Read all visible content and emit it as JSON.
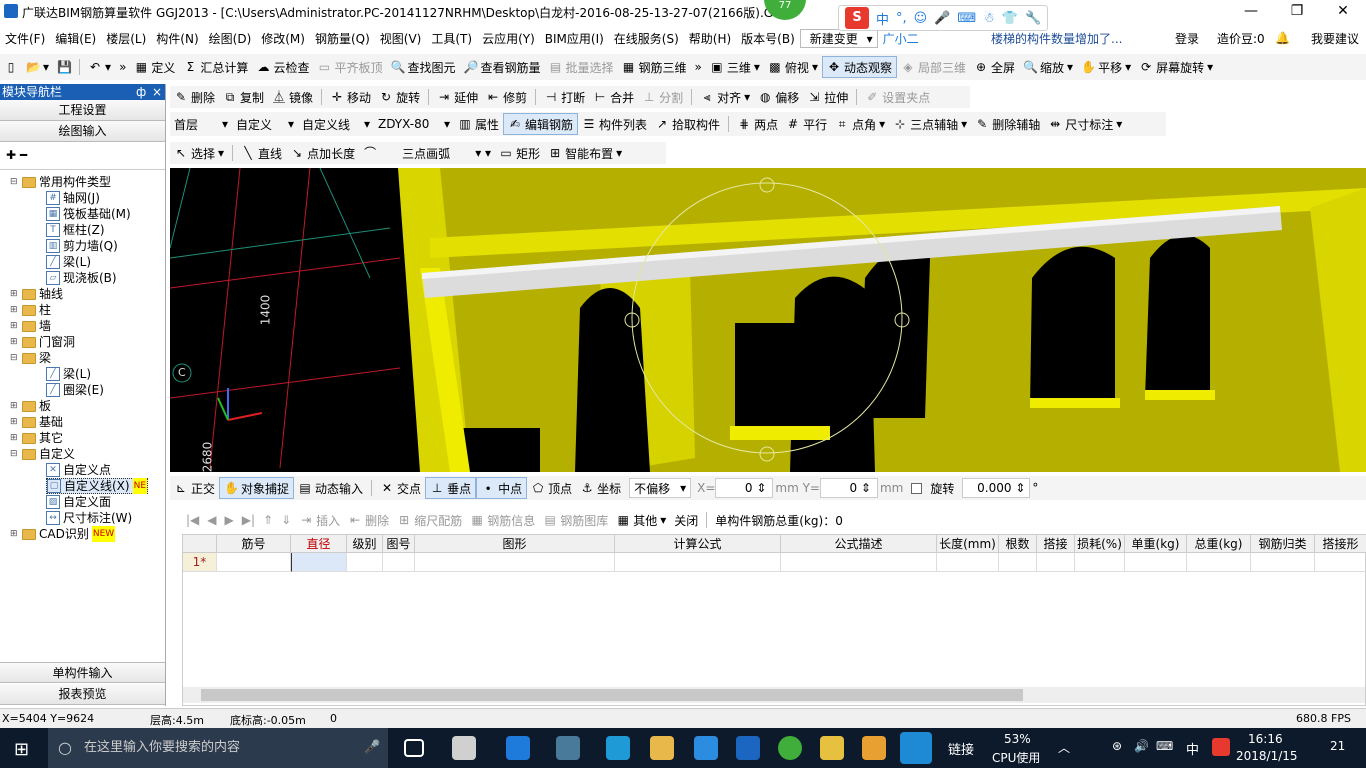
{
  "window": {
    "title": "广联达BIM钢筋算量软件 GGJ2013 - [C:\\Users\\Administrator.PC-20141127NRHM\\Desktop\\白龙村-2016-08-25-13-27-07(2166版).GG",
    "badge": "77",
    "min": "—",
    "max": "❐",
    "close": "✕"
  },
  "ime": {
    "logo": "S",
    "mode": "中",
    "punct": "°,"
  },
  "menu": {
    "items": [
      "文件(F)",
      "编辑(E)",
      "楼层(L)",
      "构件(N)",
      "绘图(D)",
      "修改(M)",
      "钢筋量(Q)",
      "视图(V)",
      "工具(T)",
      "云应用(Y)",
      "BIM应用(I)",
      "在线服务(S)",
      "帮助(H)",
      "版本号(B)"
    ],
    "new_change": "新建变更",
    "guangxiaoer": "广小二",
    "notice": "楼梯的构件数量增加了...",
    "login": "登录",
    "beans": "造价豆:0",
    "suggest": "我要建议"
  },
  "toolbar1": {
    "items": [
      "定义",
      "汇总计算",
      "云检查",
      "平齐板顶",
      "查找图元",
      "查看钢筋量",
      "批量选择",
      "钢筋三维",
      "三维",
      "俯视",
      "动态观察",
      "局部三维",
      "全屏",
      "缩放",
      "平移",
      "屏幕旋转"
    ]
  },
  "toolbar2": {
    "items": [
      "删除",
      "复制",
      "镜像",
      "移动",
      "旋转",
      "延伸",
      "修剪",
      "打断",
      "合并",
      "分割",
      "对齐",
      "偏移",
      "拉伸",
      "设置夹点"
    ]
  },
  "toolbar3": {
    "floor": "首层",
    "custom": "自定义",
    "custom_line": "自定义线",
    "code": "ZDYX-80",
    "items": [
      "属性",
      "编辑钢筋",
      "构件列表",
      "拾取构件",
      "两点",
      "平行",
      "点角",
      "三点辅轴",
      "删除辅轴",
      "尺寸标注"
    ]
  },
  "toolbar4": {
    "items": [
      "选择",
      "直线",
      "点加长度",
      "三点画弧",
      "矩形",
      "智能布置"
    ]
  },
  "nav": {
    "title": "模块导航栏",
    "pin": "ф",
    "close": "×",
    "btn_project": "工程设置",
    "btn_draw": "绘图输入",
    "tree": [
      {
        "label": "常用构件类型",
        "level": 0,
        "exp": "⊟",
        "type": "folder"
      },
      {
        "label": "轴网(J)",
        "level": 1,
        "type": "leaf",
        "glyph": "#"
      },
      {
        "label": "筏板基础(M)",
        "level": 1,
        "type": "leaf",
        "glyph": "▦"
      },
      {
        "label": "框柱(Z)",
        "level": 1,
        "type": "leaf",
        "glyph": "T"
      },
      {
        "label": "剪力墙(Q)",
        "level": 1,
        "type": "leaf",
        "glyph": "▥"
      },
      {
        "label": "梁(L)",
        "level": 1,
        "type": "leaf",
        "glyph": "╱"
      },
      {
        "label": "现浇板(B)",
        "level": 1,
        "type": "leaf",
        "glyph": "▱"
      },
      {
        "label": "轴线",
        "level": 0,
        "exp": "⊞",
        "type": "folder"
      },
      {
        "label": "柱",
        "level": 0,
        "exp": "⊞",
        "type": "folder"
      },
      {
        "label": "墙",
        "level": 0,
        "exp": "⊞",
        "type": "folder"
      },
      {
        "label": "门窗洞",
        "level": 0,
        "exp": "⊞",
        "type": "folder"
      },
      {
        "label": "梁",
        "level": 0,
        "exp": "⊟",
        "type": "folder"
      },
      {
        "label": "梁(L)",
        "level": 1,
        "type": "leaf",
        "glyph": "╱"
      },
      {
        "label": "圈梁(E)",
        "level": 1,
        "type": "leaf",
        "glyph": "╱"
      },
      {
        "label": "板",
        "level": 0,
        "exp": "⊞",
        "type": "folder"
      },
      {
        "label": "基础",
        "level": 0,
        "exp": "⊞",
        "type": "folder"
      },
      {
        "label": "其它",
        "level": 0,
        "exp": "⊞",
        "type": "folder"
      },
      {
        "label": "自定义",
        "level": 0,
        "exp": "⊟",
        "type": "folder"
      },
      {
        "label": "自定义点",
        "level": 1,
        "type": "leaf",
        "glyph": "✕"
      },
      {
        "label": "自定义线(X)",
        "level": 1,
        "type": "leaf",
        "glyph": "▢",
        "tag": "NE"
      },
      {
        "label": "自定义面",
        "level": 1,
        "type": "leaf",
        "glyph": "▨"
      },
      {
        "label": "尺寸标注(W)",
        "level": 1,
        "type": "leaf",
        "glyph": "↔"
      },
      {
        "label": "CAD识别",
        "level": 0,
        "exp": "⊞",
        "type": "folder",
        "tag": "NEW"
      }
    ],
    "btn_single": "单构件输入",
    "btn_report": "报表预览"
  },
  "viewport": {
    "dim1": "1400",
    "dim2": "2680",
    "axis_mark": "C"
  },
  "snapbar": {
    "ortho": "正交",
    "snap": "对象捕捉",
    "dyn": "动态输入",
    "intersect": "交点",
    "perp": "垂点",
    "mid": "中点",
    "vertex": "顶点",
    "coord": "坐标",
    "offset": "不偏移",
    "x_label": "X=",
    "x_val": "0",
    "y_label": "mm Y=",
    "y_val": "0",
    "unit": "mm",
    "rotate": "旋转",
    "rot_val": "0.000",
    "deg": "°"
  },
  "gridtb": {
    "insert": "插入",
    "delete": "删除",
    "scale": "缩尺配筋",
    "info": "钢筋信息",
    "lib": "钢筋图库",
    "other": "其他",
    "close": "关闭",
    "total": "单构件钢筋总重(kg)：0"
  },
  "grid": {
    "headers": [
      "",
      "筋号",
      "直径(mm)",
      "级别",
      "图号",
      "图形",
      "计算公式",
      "公式描述",
      "长度(mm)",
      "根数",
      "搭接",
      "损耗(%)",
      "单重(kg)",
      "总重(kg)",
      "钢筋归类",
      "搭接形"
    ],
    "row1_index": "1*"
  },
  "status": {
    "coords": "X=5404 Y=9624",
    "floor_h": "层高:4.5m",
    "bottom_h": "底标高:-0.05m",
    "val": "0",
    "fps": "680.8 FPS"
  },
  "taskbar": {
    "search_placeholder": "在这里输入你要搜索的内容",
    "link": "链接",
    "cpu": "53%",
    "cpu_label": "CPU使用",
    "lang": "中",
    "time": "16:16",
    "date": "2018/1/15",
    "notif": "21"
  }
}
